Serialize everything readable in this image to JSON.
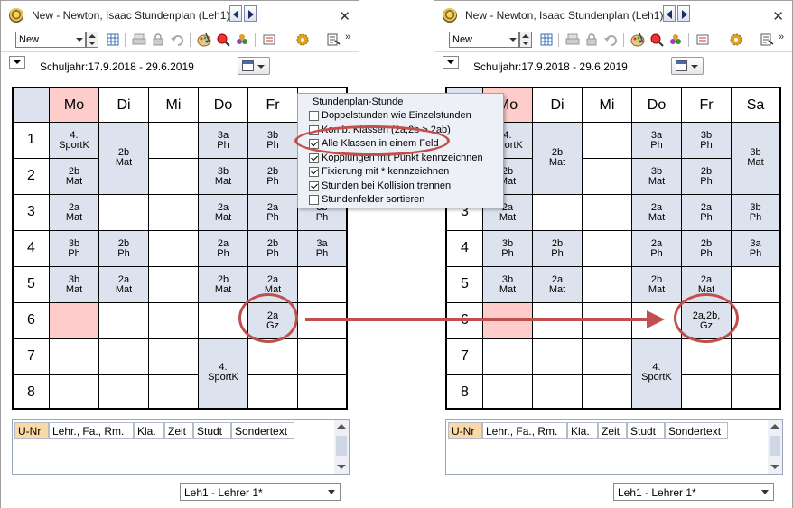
{
  "colors": {
    "today": "#ffcccc",
    "lesson": "#dde3ee",
    "highlight": "#c0504d",
    "selected_col": "#fbd9a6"
  },
  "windows": [
    {
      "title": "New - Newton, Isaac  Stundenplan  (Leh1)",
      "toolbar": {
        "combo_value": "New",
        "icons": [
          "grid-icon",
          "print-icon",
          "lock-icon",
          "undo-icon",
          "palette-icon",
          "magnify-icon",
          "group-icon",
          "settings-icon",
          "gear-icon",
          "export-icon"
        ]
      },
      "schoolyear": "Schuljahr:17.9.2018 - 29.6.2019",
      "days": [
        "Mo",
        "Di",
        "Mi",
        "Do",
        "Fr",
        "Sa"
      ],
      "periods": [
        "1",
        "2",
        "3",
        "4",
        "5",
        "6",
        "7",
        "8"
      ],
      "cells": [
        {
          "d": 0,
          "p": 0,
          "t": [
            "4.",
            "SportK"
          ]
        },
        {
          "d": 0,
          "p": 1,
          "t": [
            "2b",
            "Mat"
          ]
        },
        {
          "d": 0,
          "p": 2,
          "t": [
            "2a",
            "Mat"
          ]
        },
        {
          "d": 0,
          "p": 3,
          "t": [
            "3b",
            "Ph"
          ]
        },
        {
          "d": 0,
          "p": 4,
          "t": [
            "3b",
            "Mat"
          ]
        },
        {
          "d": 1,
          "p": 0,
          "span": 2,
          "t": [
            "2b",
            "Mat"
          ]
        },
        {
          "d": 1,
          "p": 3,
          "t": [
            "2b",
            "Ph"
          ]
        },
        {
          "d": 1,
          "p": 4,
          "t": [
            "2a",
            "Mat"
          ]
        },
        {
          "d": 3,
          "p": 0,
          "t": [
            "3a",
            "Ph"
          ]
        },
        {
          "d": 3,
          "p": 1,
          "t": [
            "3b",
            "Mat"
          ]
        },
        {
          "d": 3,
          "p": 2,
          "t": [
            "2a",
            "Mat"
          ]
        },
        {
          "d": 3,
          "p": 3,
          "t": [
            "2a",
            "Ph"
          ]
        },
        {
          "d": 3,
          "p": 4,
          "t": [
            "2b",
            "Mat"
          ]
        },
        {
          "d": 3,
          "p": 6,
          "span": 2,
          "t": [
            "4.",
            "SportK"
          ]
        },
        {
          "d": 4,
          "p": 0,
          "t": [
            "3b",
            "Ph"
          ]
        },
        {
          "d": 4,
          "p": 1,
          "t": [
            "2b",
            "Ph"
          ]
        },
        {
          "d": 4,
          "p": 2,
          "t": [
            "2a",
            "Ph"
          ]
        },
        {
          "d": 4,
          "p": 3,
          "t": [
            "2b",
            "Ph"
          ]
        },
        {
          "d": 4,
          "p": 4,
          "t": [
            "2a",
            "Mat"
          ]
        },
        {
          "d": 4,
          "p": 5,
          "t": [
            "2a",
            "Gz"
          ]
        },
        {
          "d": 5,
          "p": 0,
          "span": 2,
          "t": [
            "3b",
            "Mat"
          ]
        },
        {
          "d": 5,
          "p": 2,
          "t": [
            "3b",
            "Ph"
          ]
        },
        {
          "d": 5,
          "p": 3,
          "t": [
            "3a",
            "Ph"
          ]
        }
      ],
      "pink_cells": [
        {
          "d": 0,
          "p": 5
        }
      ],
      "columns": [
        "U-Nr",
        "Lehr., Fa., Rm.",
        "Kla.",
        "Zeit",
        "Studt",
        "Sondertext"
      ],
      "teacher": "Leh1 - Lehrer 1*"
    },
    {
      "title": "New - Newton, Isaac  Stundenplan  (Leh1)",
      "toolbar": {
        "combo_value": "New"
      },
      "schoolyear": "Schuljahr:17.9.2018 - 29.6.2019",
      "days": [
        "Mo",
        "Di",
        "Mi",
        "Do",
        "Fr",
        "Sa"
      ],
      "periods": [
        "1",
        "2",
        "3",
        "4",
        "5",
        "6",
        "7",
        "8"
      ],
      "cells": [
        {
          "d": 0,
          "p": 0,
          "t": [
            "4.",
            "SportK"
          ]
        },
        {
          "d": 0,
          "p": 1,
          "t": [
            "2b",
            "Mat"
          ]
        },
        {
          "d": 0,
          "p": 2,
          "t": [
            "2a",
            "Mat"
          ]
        },
        {
          "d": 0,
          "p": 3,
          "t": [
            "3b",
            "Ph"
          ]
        },
        {
          "d": 0,
          "p": 4,
          "t": [
            "3b",
            "Mat"
          ]
        },
        {
          "d": 1,
          "p": 0,
          "span": 2,
          "t": [
            "2b",
            "Mat"
          ]
        },
        {
          "d": 1,
          "p": 3,
          "t": [
            "2b",
            "Ph"
          ]
        },
        {
          "d": 1,
          "p": 4,
          "t": [
            "2a",
            "Mat"
          ]
        },
        {
          "d": 3,
          "p": 0,
          "t": [
            "3a",
            "Ph"
          ]
        },
        {
          "d": 3,
          "p": 1,
          "t": [
            "3b",
            "Mat"
          ]
        },
        {
          "d": 3,
          "p": 2,
          "t": [
            "2a",
            "Mat"
          ]
        },
        {
          "d": 3,
          "p": 3,
          "t": [
            "2a",
            "Ph"
          ]
        },
        {
          "d": 3,
          "p": 4,
          "t": [
            "2b",
            "Mat"
          ]
        },
        {
          "d": 3,
          "p": 6,
          "span": 2,
          "t": [
            "4.",
            "SportK"
          ]
        },
        {
          "d": 4,
          "p": 0,
          "t": [
            "3b",
            "Ph"
          ]
        },
        {
          "d": 4,
          "p": 1,
          "t": [
            "2b",
            "Ph"
          ]
        },
        {
          "d": 4,
          "p": 2,
          "t": [
            "2a",
            "Ph"
          ]
        },
        {
          "d": 4,
          "p": 3,
          "t": [
            "2b",
            "Ph"
          ]
        },
        {
          "d": 4,
          "p": 4,
          "t": [
            "2a",
            "Mat"
          ]
        },
        {
          "d": 4,
          "p": 5,
          "t": [
            "2a,2b,",
            "Gz"
          ]
        },
        {
          "d": 5,
          "p": 0,
          "span": 2,
          "t": [
            "3b",
            "Mat"
          ]
        },
        {
          "d": 5,
          "p": 2,
          "t": [
            "3b",
            "Ph"
          ]
        },
        {
          "d": 5,
          "p": 3,
          "t": [
            "3a",
            "Ph"
          ]
        }
      ],
      "pink_cells": [
        {
          "d": 0,
          "p": 5
        }
      ],
      "columns": [
        "U-Nr",
        "Lehr., Fa., Rm.",
        "Kla.",
        "Zeit",
        "Studt",
        "Sondertext"
      ],
      "teacher": "Leh1 - Lehrer 1*"
    }
  ],
  "popup": {
    "title": "Stundenplan-Stunde",
    "items": [
      {
        "label": "Doppelstunden wie Einzelstunden",
        "checked": false
      },
      {
        "label": "Komb. Klassen (2a,2b > 2ab)",
        "checked": false
      },
      {
        "label": "Alle Klassen in einem Feld",
        "checked": true
      },
      {
        "label": "Kopplungen mit Punkt kennzeichnen",
        "checked": true
      },
      {
        "label": "Fixierung mit * kennzeichnen",
        "checked": true
      },
      {
        "label": "Stunden bei Kollision trennen",
        "checked": true
      },
      {
        "label": "Stundenfelder sortieren",
        "checked": false
      }
    ]
  }
}
